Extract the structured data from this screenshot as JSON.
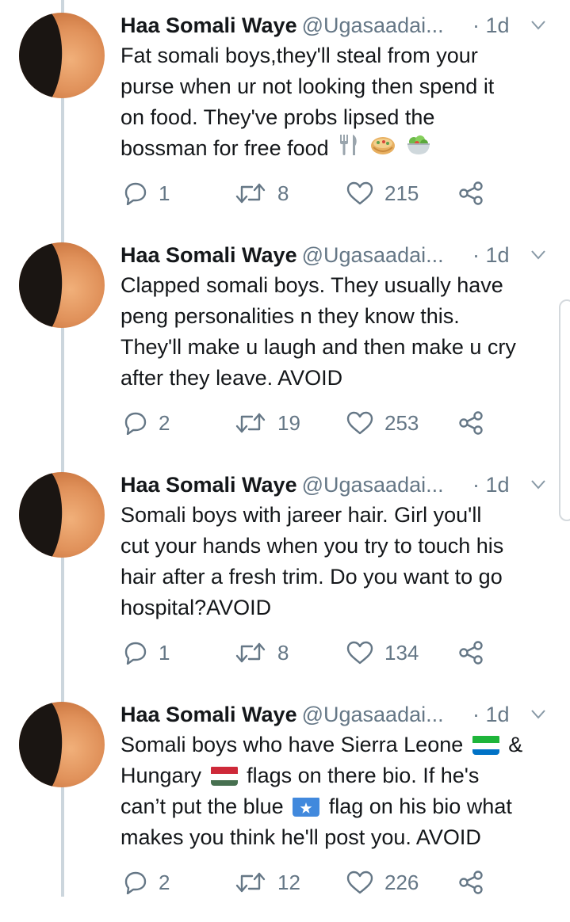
{
  "tweets": [
    {
      "name": "Haa Somali Waye",
      "handle": "@Ugasaadai...",
      "time": "· 1d",
      "lines": [
        "Fat somali boys,they'll steal from your",
        "purse when ur not looking then spend it",
        "on food. They've probs lipsed the",
        "bossman for free food"
      ],
      "emojis": [
        "fork-and-knife-emoji",
        "burrito-emoji",
        "salad-emoji"
      ],
      "replies": "1",
      "retweets": "8",
      "likes": "215"
    },
    {
      "name": "Haa Somali Waye",
      "handle": "@Ugasaadai...",
      "time": "· 1d",
      "lines": [
        "Clapped somali boys. They usually have",
        "peng personalities n they know this.",
        "They'll make u laugh and then make u cry",
        "after they leave. AVOID"
      ],
      "replies": "2",
      "retweets": "19",
      "likes": "253"
    },
    {
      "name": "Haa Somali Waye",
      "handle": "@Ugasaadai...",
      "time": "· 1d",
      "lines": [
        "Somali boys with jareer hair. Girl you'll",
        "cut your hands when you try to touch his",
        "hair after a fresh trim. Do you want to go",
        "hospital?AVOID"
      ],
      "replies": "1",
      "retweets": "8",
      "likes": "134"
    },
    {
      "name": "Haa Somali Waye",
      "handle": "@Ugasaadai...",
      "time": "· 1d",
      "line1a": "Somali boys who have Sierra Leone",
      "line1b": "&",
      "line2a": "Hungary",
      "line2b": "flags on there bio. If he's",
      "line3a": "can’t put the blue",
      "line3b": "flag on his bio what",
      "line4": "makes you think he'll post you. AVOID",
      "flags": [
        "sierra-leone-flag",
        "hungary-flag",
        "somalia-flag"
      ],
      "replies": "2",
      "retweets": "12",
      "likes": "226"
    }
  ],
  "colors": {
    "name_text": "#14171a",
    "secondary_text": "#657786",
    "thread_line": "#ccd6dd",
    "background": "#ffffff"
  }
}
